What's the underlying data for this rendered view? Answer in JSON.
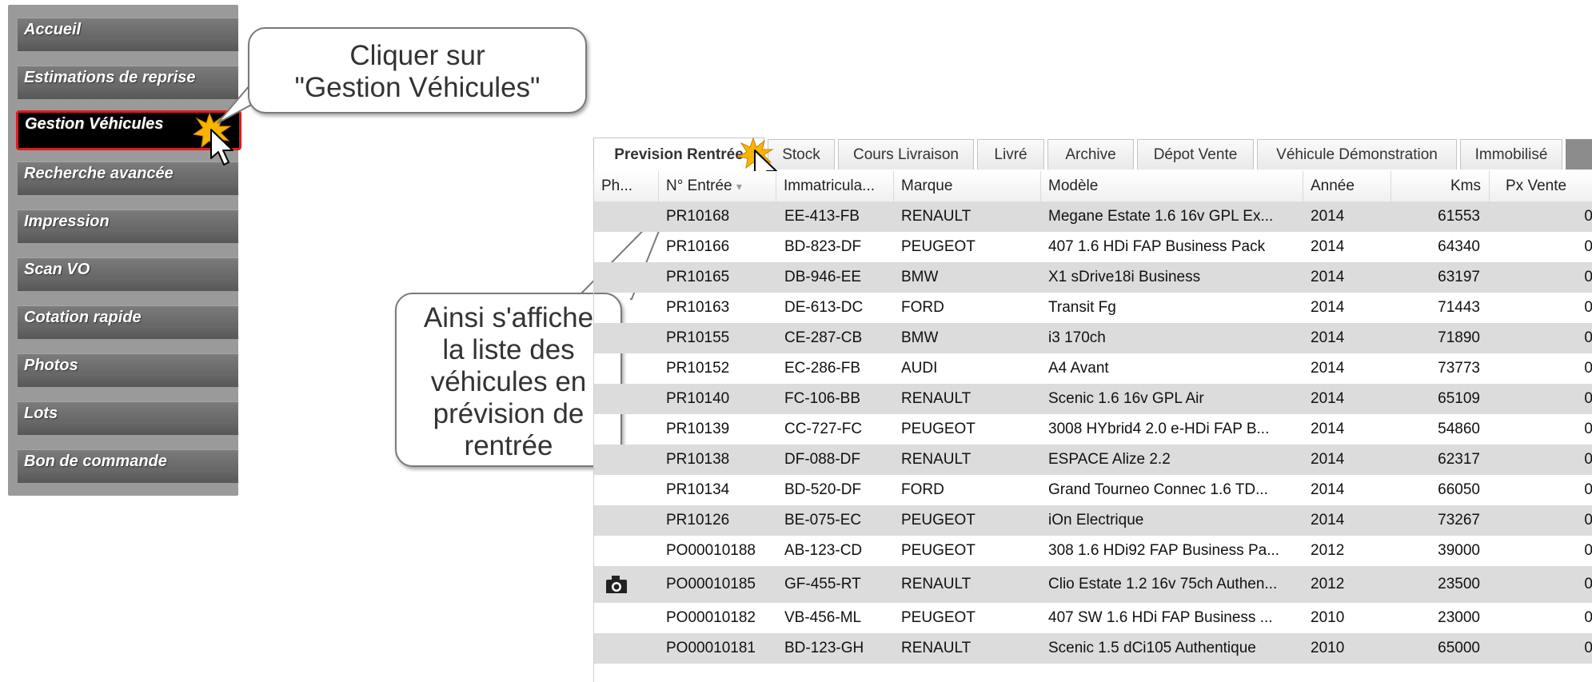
{
  "sidebar": {
    "items": [
      {
        "label": "Accueil"
      },
      {
        "label": "Estimations de reprise"
      },
      {
        "label": "Gestion Véhicules"
      },
      {
        "label": "Recherche avancée"
      },
      {
        "label": "Impression"
      },
      {
        "label": "Scan VO"
      },
      {
        "label": "Cotation rapide"
      },
      {
        "label": "Photos"
      },
      {
        "label": "Lots"
      },
      {
        "label": "Bon de commande"
      }
    ]
  },
  "callouts": {
    "top": {
      "line1": "Cliquer sur",
      "line2": "\"Gestion Véhicules\""
    },
    "middle": {
      "line1": "Ainsi s'affiche",
      "line2": "la liste des",
      "line3": "véhicules en",
      "line4": "prévision de",
      "line5": "rentrée"
    }
  },
  "tabs": [
    {
      "label": "Prevision Rentrée"
    },
    {
      "label": "Stock"
    },
    {
      "label": "Cours Livraison"
    },
    {
      "label": "Livré"
    },
    {
      "label": "Archive"
    },
    {
      "label": "Dépot Vente"
    },
    {
      "label": "Véhicule Démonstration"
    },
    {
      "label": "Immobilisé"
    }
  ],
  "grid": {
    "columns": [
      "Ph...",
      "N° Entrée",
      "Immatricula...",
      "Marque",
      "Modèle",
      "Année",
      "Kms",
      "Px Vente"
    ],
    "rows": [
      {
        "entree": "PR10168",
        "immat": "EE-413-FB",
        "marque": "RENAULT",
        "modele": "Megane Estate 1.6 16v GPL Ex...",
        "annee": "2014",
        "kms": "61553",
        "px": "0"
      },
      {
        "entree": "PR10166",
        "immat": "BD-823-DF",
        "marque": "PEUGEOT",
        "modele": "407 1.6 HDi FAP Business Pack",
        "annee": "2014",
        "kms": "64340",
        "px": "0"
      },
      {
        "entree": "PR10165",
        "immat": "DB-946-EE",
        "marque": "BMW",
        "modele": "X1 sDrive18i Business",
        "annee": "2014",
        "kms": "63197",
        "px": "0"
      },
      {
        "entree": "PR10163",
        "immat": "DE-613-DC",
        "marque": "FORD",
        "modele": "Transit Fg",
        "annee": "2014",
        "kms": "71443",
        "px": "0"
      },
      {
        "entree": "PR10155",
        "immat": "CE-287-CB",
        "marque": "BMW",
        "modele": "i3 170ch",
        "annee": "2014",
        "kms": "71890",
        "px": "0"
      },
      {
        "entree": "PR10152",
        "immat": "EC-286-FB",
        "marque": "AUDI",
        "modele": "A4 Avant",
        "annee": "2014",
        "kms": "73773",
        "px": "0"
      },
      {
        "entree": "PR10140",
        "immat": "FC-106-BB",
        "marque": "RENAULT",
        "modele": "Scenic 1.6 16v GPL Air",
        "annee": "2014",
        "kms": "65109",
        "px": "0"
      },
      {
        "entree": "PR10139",
        "immat": "CC-727-FC",
        "marque": "PEUGEOT",
        "modele": "3008 HYbrid4 2.0 e-HDi FAP B...",
        "annee": "2014",
        "kms": "54860",
        "px": "0"
      },
      {
        "entree": "PR10138",
        "immat": "DF-088-DF",
        "marque": "RENAULT",
        "modele": "ESPACE Alize 2.2",
        "annee": "2014",
        "kms": "62317",
        "px": "0"
      },
      {
        "entree": "PR10134",
        "immat": "BD-520-DF",
        "marque": "FORD",
        "modele": "Grand Tourneo Connec 1.6 TD...",
        "annee": "2014",
        "kms": "66050",
        "px": "0"
      },
      {
        "entree": "PR10126",
        "immat": "BE-075-EC",
        "marque": "PEUGEOT",
        "modele": "iOn Electrique",
        "annee": "2014",
        "kms": "73267",
        "px": "0"
      },
      {
        "entree": "PO00010188",
        "immat": "AB-123-CD",
        "marque": "PEUGEOT",
        "modele": "308 1.6 HDi92 FAP Business Pa...",
        "annee": "2012",
        "kms": "39000",
        "px": "0"
      },
      {
        "entree": "PO00010185",
        "immat": "GF-455-RT",
        "marque": "RENAULT",
        "modele": "Clio Estate 1.2 16v 75ch Authen...",
        "annee": "2012",
        "kms": "23500",
        "px": "0",
        "photo": true
      },
      {
        "entree": "PO00010182",
        "immat": "VB-456-ML",
        "marque": "PEUGEOT",
        "modele": "407 SW 1.6 HDi FAP Business ...",
        "annee": "2010",
        "kms": "23000",
        "px": "0"
      },
      {
        "entree": "PO00010181",
        "immat": "BD-123-GH",
        "marque": "RENAULT",
        "modele": "Scenic 1.5 dCi105 Authentique",
        "annee": "2010",
        "kms": "65000",
        "px": "0"
      }
    ]
  }
}
